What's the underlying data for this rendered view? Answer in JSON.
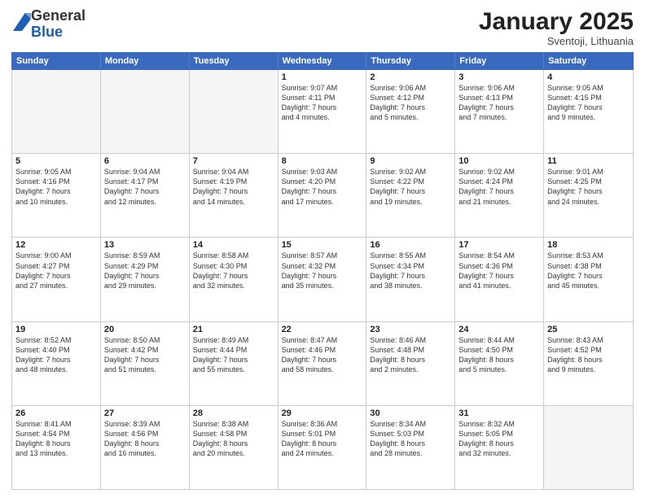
{
  "header": {
    "logo_general": "General",
    "logo_blue": "Blue",
    "month_title": "January 2025",
    "location": "Sventoji, Lithuania"
  },
  "days_of_week": [
    "Sunday",
    "Monday",
    "Tuesday",
    "Wednesday",
    "Thursday",
    "Friday",
    "Saturday"
  ],
  "weeks": [
    [
      {
        "day": "",
        "info": "",
        "empty": true
      },
      {
        "day": "",
        "info": "",
        "empty": true
      },
      {
        "day": "",
        "info": "",
        "empty": true
      },
      {
        "day": "1",
        "info": "Sunrise: 9:07 AM\nSunset: 4:11 PM\nDaylight: 7 hours\nand 4 minutes.",
        "empty": false
      },
      {
        "day": "2",
        "info": "Sunrise: 9:06 AM\nSunset: 4:12 PM\nDaylight: 7 hours\nand 5 minutes.",
        "empty": false
      },
      {
        "day": "3",
        "info": "Sunrise: 9:06 AM\nSunset: 4:13 PM\nDaylight: 7 hours\nand 7 minutes.",
        "empty": false
      },
      {
        "day": "4",
        "info": "Sunrise: 9:05 AM\nSunset: 4:15 PM\nDaylight: 7 hours\nand 9 minutes.",
        "empty": false
      }
    ],
    [
      {
        "day": "5",
        "info": "Sunrise: 9:05 AM\nSunset: 4:16 PM\nDaylight: 7 hours\nand 10 minutes.",
        "empty": false
      },
      {
        "day": "6",
        "info": "Sunrise: 9:04 AM\nSunset: 4:17 PM\nDaylight: 7 hours\nand 12 minutes.",
        "empty": false
      },
      {
        "day": "7",
        "info": "Sunrise: 9:04 AM\nSunset: 4:19 PM\nDaylight: 7 hours\nand 14 minutes.",
        "empty": false
      },
      {
        "day": "8",
        "info": "Sunrise: 9:03 AM\nSunset: 4:20 PM\nDaylight: 7 hours\nand 17 minutes.",
        "empty": false
      },
      {
        "day": "9",
        "info": "Sunrise: 9:02 AM\nSunset: 4:22 PM\nDaylight: 7 hours\nand 19 minutes.",
        "empty": false
      },
      {
        "day": "10",
        "info": "Sunrise: 9:02 AM\nSunset: 4:24 PM\nDaylight: 7 hours\nand 21 minutes.",
        "empty": false
      },
      {
        "day": "11",
        "info": "Sunrise: 9:01 AM\nSunset: 4:25 PM\nDaylight: 7 hours\nand 24 minutes.",
        "empty": false
      }
    ],
    [
      {
        "day": "12",
        "info": "Sunrise: 9:00 AM\nSunset: 4:27 PM\nDaylight: 7 hours\nand 27 minutes.",
        "empty": false
      },
      {
        "day": "13",
        "info": "Sunrise: 8:59 AM\nSunset: 4:29 PM\nDaylight: 7 hours\nand 29 minutes.",
        "empty": false
      },
      {
        "day": "14",
        "info": "Sunrise: 8:58 AM\nSunset: 4:30 PM\nDaylight: 7 hours\nand 32 minutes.",
        "empty": false
      },
      {
        "day": "15",
        "info": "Sunrise: 8:57 AM\nSunset: 4:32 PM\nDaylight: 7 hours\nand 35 minutes.",
        "empty": false
      },
      {
        "day": "16",
        "info": "Sunrise: 8:55 AM\nSunset: 4:34 PM\nDaylight: 7 hours\nand 38 minutes.",
        "empty": false
      },
      {
        "day": "17",
        "info": "Sunrise: 8:54 AM\nSunset: 4:36 PM\nDaylight: 7 hours\nand 41 minutes.",
        "empty": false
      },
      {
        "day": "18",
        "info": "Sunrise: 8:53 AM\nSunset: 4:38 PM\nDaylight: 7 hours\nand 45 minutes.",
        "empty": false
      }
    ],
    [
      {
        "day": "19",
        "info": "Sunrise: 8:52 AM\nSunset: 4:40 PM\nDaylight: 7 hours\nand 48 minutes.",
        "empty": false
      },
      {
        "day": "20",
        "info": "Sunrise: 8:50 AM\nSunset: 4:42 PM\nDaylight: 7 hours\nand 51 minutes.",
        "empty": false
      },
      {
        "day": "21",
        "info": "Sunrise: 8:49 AM\nSunset: 4:44 PM\nDaylight: 7 hours\nand 55 minutes.",
        "empty": false
      },
      {
        "day": "22",
        "info": "Sunrise: 8:47 AM\nSunset: 4:46 PM\nDaylight: 7 hours\nand 58 minutes.",
        "empty": false
      },
      {
        "day": "23",
        "info": "Sunrise: 8:46 AM\nSunset: 4:48 PM\nDaylight: 8 hours\nand 2 minutes.",
        "empty": false
      },
      {
        "day": "24",
        "info": "Sunrise: 8:44 AM\nSunset: 4:50 PM\nDaylight: 8 hours\nand 5 minutes.",
        "empty": false
      },
      {
        "day": "25",
        "info": "Sunrise: 8:43 AM\nSunset: 4:52 PM\nDaylight: 8 hours\nand 9 minutes.",
        "empty": false
      }
    ],
    [
      {
        "day": "26",
        "info": "Sunrise: 8:41 AM\nSunset: 4:54 PM\nDaylight: 8 hours\nand 13 minutes.",
        "empty": false
      },
      {
        "day": "27",
        "info": "Sunrise: 8:39 AM\nSunset: 4:56 PM\nDaylight: 8 hours\nand 16 minutes.",
        "empty": false
      },
      {
        "day": "28",
        "info": "Sunrise: 8:38 AM\nSunset: 4:58 PM\nDaylight: 8 hours\nand 20 minutes.",
        "empty": false
      },
      {
        "day": "29",
        "info": "Sunrise: 8:36 AM\nSunset: 5:01 PM\nDaylight: 8 hours\nand 24 minutes.",
        "empty": false
      },
      {
        "day": "30",
        "info": "Sunrise: 8:34 AM\nSunset: 5:03 PM\nDaylight: 8 hours\nand 28 minutes.",
        "empty": false
      },
      {
        "day": "31",
        "info": "Sunrise: 8:32 AM\nSunset: 5:05 PM\nDaylight: 8 hours\nand 32 minutes.",
        "empty": false
      },
      {
        "day": "",
        "info": "",
        "empty": true
      }
    ]
  ]
}
